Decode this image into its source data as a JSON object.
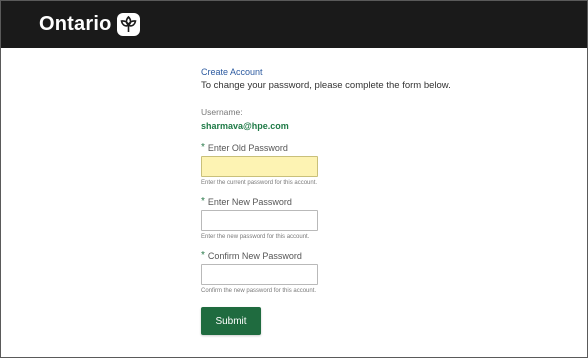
{
  "header": {
    "brand_text": "Ontario",
    "logo_icon": "trillium-icon",
    "background": "#1a1a1a"
  },
  "form": {
    "create_account_link": "Create Account",
    "intro_text": "To change your password, please complete the form below.",
    "username_label": "Username:",
    "username_value": "sharmava@hpe.com",
    "required_marker": "*",
    "old_password": {
      "label": "Enter Old Password",
      "hint": "Enter the current password for this account.",
      "value": ""
    },
    "new_password": {
      "label": "Enter New Password",
      "hint": "Enter the new password for this account.",
      "value": ""
    },
    "confirm_password": {
      "label": "Confirm New Password",
      "hint": "Confirm the new password for this account.",
      "value": ""
    },
    "submit_label": "Submit",
    "accent_color": "#1f6b3f",
    "highlight_color": "#fdf3b3"
  }
}
